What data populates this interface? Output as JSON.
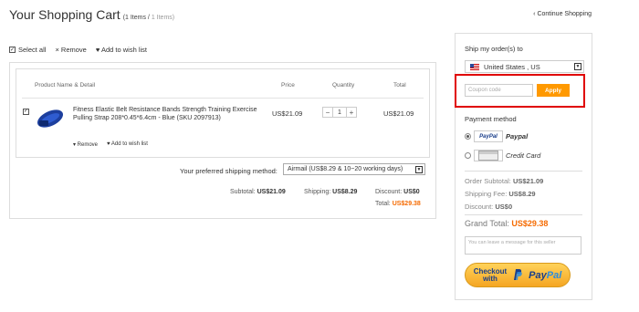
{
  "header": {
    "title": "Your Shopping Cart",
    "count_open": "(1 Items /",
    "count_muted": "1 Items)",
    "continue": "‹ Continue Shopping"
  },
  "actions": {
    "select_all": "Select all",
    "remove": "× Remove",
    "wishlist": "♥ Add to wish list"
  },
  "table": {
    "headers": {
      "product": "Product Name & Detail",
      "price": "Price",
      "quantity": "Quantity",
      "total": "Total"
    },
    "item": {
      "title": "Fitness Elastic Belt Resistance Bands Strength Training Exercise Pulling Strap 208*0.45*6.4cm - Blue (SKU 2097913)",
      "remove": "▾ Remove",
      "wishlist": "♥ Add to wish list",
      "price": "US$21.09",
      "quantity": "1",
      "total": "US$21.09",
      "minus": "−",
      "plus": "+"
    }
  },
  "shipping": {
    "label": "Your preferred shipping method:",
    "selected": "Airmail (US$8.29 & 10~20 working days)"
  },
  "summary": {
    "subtotal_label": "Subtotal:",
    "subtotal": "US$21.09",
    "shipping_label": "Shipping:",
    "shipping": "US$8.29",
    "discount_label": "Discount:",
    "discount": "US$0",
    "total_label": "Total:",
    "total": "US$29.38"
  },
  "sidebar": {
    "ship_to_label": "Ship my order(s) to",
    "country": "United States , US",
    "coupon_placeholder": "Coupon code",
    "apply": "Apply",
    "payment_label": "Payment method",
    "paypal_logo": "PayPal",
    "paypal": "Paypal",
    "credit_card": "Credit Card",
    "order_subtotal_label": "Order Subtotal:",
    "order_subtotal": "US$21.09",
    "shipping_fee_label": "Shipping Fee:",
    "shipping_fee": "US$8.29",
    "discount_label": "Discount:",
    "discount": "US$0",
    "grand_total_label": "Grand Total:",
    "grand_total": "US$29.38",
    "message_placeholder": "You can leave a message for this seller",
    "checkout_line1": "Checkout",
    "checkout_line2": "with",
    "checkout_brand_pay": "Pay",
    "checkout_brand_pal": "Pal"
  },
  "colors": {
    "accent": "#f56a00",
    "apply_button": "#ff9900",
    "highlight_border": "#e00000",
    "paypal_blue": "#1a3e8a"
  }
}
